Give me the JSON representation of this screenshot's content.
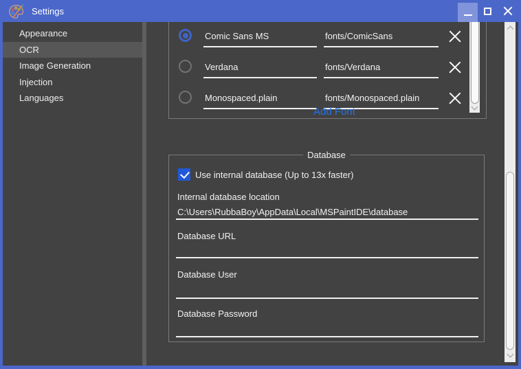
{
  "window": {
    "title": "Settings"
  },
  "titlebar": {
    "minimize": "minimize",
    "maximize": "maximize",
    "close": "close"
  },
  "sidebar": {
    "items": [
      {
        "label": "Appearance",
        "selected": false
      },
      {
        "label": "OCR",
        "selected": true
      },
      {
        "label": "Image Generation",
        "selected": false
      },
      {
        "label": "Injection",
        "selected": false
      },
      {
        "label": "Languages",
        "selected": false
      }
    ]
  },
  "fonts": {
    "rows": [
      {
        "name": "Comic Sans MS",
        "path": "fonts/ComicSans",
        "selected": true
      },
      {
        "name": "Verdana",
        "path": "fonts/Verdana",
        "selected": false
      },
      {
        "name": "Monospaced.plain",
        "path": "fonts/Monospaced.plain",
        "selected": false
      }
    ],
    "add_label": "Add Font"
  },
  "database": {
    "group_label": "Database",
    "checkbox_label": "Use internal database (Up to 13x faster)",
    "checked": true,
    "fields": [
      {
        "label": "Internal database location",
        "value": "C:\\Users\\RubbaBoy\\AppData\\Local\\MSPaintIDE\\database"
      },
      {
        "label": "Database URL",
        "value": ""
      },
      {
        "label": "Database User",
        "value": ""
      },
      {
        "label": "Database Password",
        "value": ""
      }
    ]
  },
  "colors": {
    "titlebar": "#4b67c9",
    "background": "#424242",
    "accent_blue": "#2058d8",
    "link_blue": "#2273ef",
    "selection": "#575757"
  }
}
